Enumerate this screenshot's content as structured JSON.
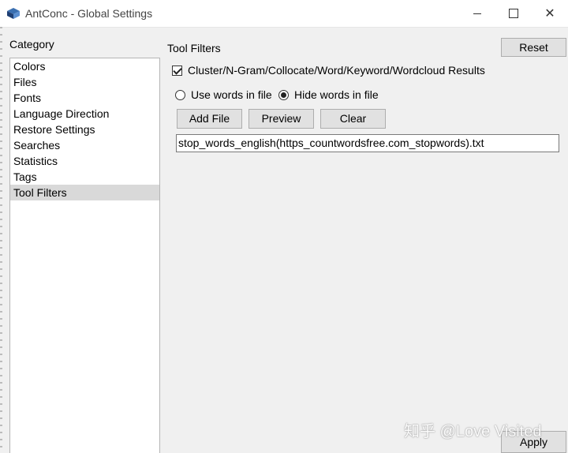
{
  "window": {
    "title": "AntConc - Global Settings",
    "minimize_glyph": "—",
    "close_glyph": "✕"
  },
  "sidebar": {
    "label": "Category",
    "items": [
      {
        "label": "Colors"
      },
      {
        "label": "Files"
      },
      {
        "label": "Fonts"
      },
      {
        "label": "Language Direction"
      },
      {
        "label": "Restore Settings"
      },
      {
        "label": "Searches"
      },
      {
        "label": "Statistics"
      },
      {
        "label": "Tags"
      },
      {
        "label": "Tool Filters",
        "selected": true
      }
    ]
  },
  "main": {
    "section_title": "Tool Filters",
    "reset_label": "Reset",
    "apply_label": "Apply",
    "checkbox_label": "Cluster/N-Gram/Collocate/Word/Keyword/Wordcloud Results",
    "checkbox_checked": true,
    "radio_use_label": "Use words in file",
    "radio_hide_label": "Hide words in file",
    "radio_selected": "hide",
    "add_file_label": "Add File",
    "preview_label": "Preview",
    "clear_label": "Clear",
    "file_value": "stop_words_english(https_countwordsfree.com_stopwords).txt"
  },
  "watermark": "知乎 @Love Visited",
  "colors": {
    "window_bg": "#f0f0f0",
    "selected_item_bg": "#d9d9d9",
    "button_bg": "#e1e1e1"
  }
}
